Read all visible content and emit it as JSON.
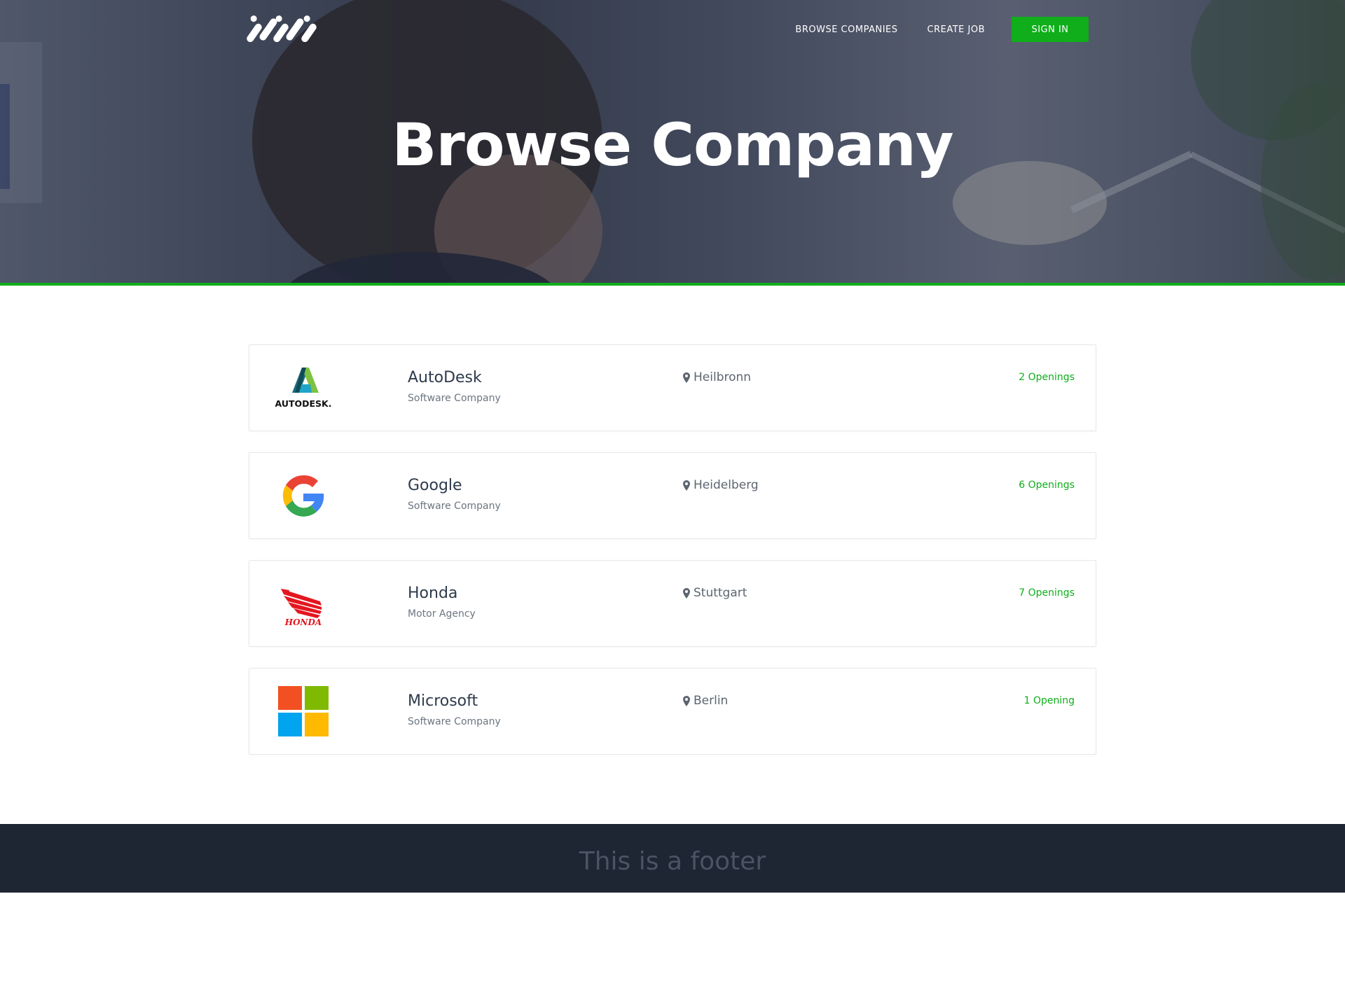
{
  "nav": {
    "browse_label": "BROWSE COMPANIES",
    "create_label": "CREATE JOB",
    "signin_label": "SIGN IN"
  },
  "hero": {
    "title": "Browse Company"
  },
  "companies": [
    {
      "name": "AutoDesk",
      "type": "Software Company",
      "location": "Heilbronn",
      "openings": "2 Openings",
      "logo": "autodesk-logo",
      "logo_text": "AUTODESK."
    },
    {
      "name": "Google",
      "type": "Software Company",
      "location": "Heidelberg",
      "openings": "6 Openings",
      "logo": "google-logo"
    },
    {
      "name": "Honda",
      "type": "Motor Agency",
      "location": "Stuttgart",
      "openings": "7 Openings",
      "logo": "honda-logo",
      "logo_text": "HONDA"
    },
    {
      "name": "Microsoft",
      "type": "Software Company",
      "location": "Berlin",
      "openings": "1 Opening",
      "logo": "microsoft-logo"
    }
  ],
  "footer": {
    "text": "This is a footer"
  },
  "colors": {
    "accent": "#0fae1a",
    "footer_bg": "#1e2533",
    "text_dark": "#2e3a4b"
  }
}
